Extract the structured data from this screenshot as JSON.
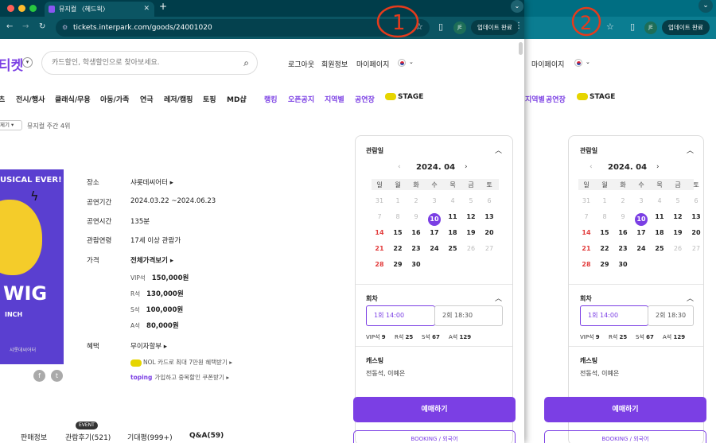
{
  "tab": {
    "title": "뮤지컬 〈헤드윅〉"
  },
  "address": {
    "url": "tickets.interpark.com/goods/24001020"
  },
  "toolbar": {
    "profile": "JE",
    "update_label": "업데이트 완료"
  },
  "header": {
    "logo": "티켓",
    "search_placeholder": "카드할인, 학생할인으로 찾아보세요.",
    "links": [
      "로그아웃",
      "회원정보",
      "마이페이지"
    ]
  },
  "menu": {
    "items": [
      "츠",
      "전시/행사",
      "클래식/무용",
      "아동/가족",
      "연극",
      "레저/캠핑",
      "토핑",
      "MD샵"
    ],
    "purple_items": [
      "랭킹",
      "오픈공지",
      "지역별",
      "공연장"
    ],
    "stage": "STAGE"
  },
  "category": {
    "select": "제기",
    "rank": "뮤지컬 주간 4위"
  },
  "poster": {
    "line1": "USICAL EVER!",
    "line2": "WIG",
    "line3": "INCH",
    "line4": "샤롯데씨어터"
  },
  "info": {
    "venue_label": "장소",
    "venue": "샤롯데씨어터 ▸",
    "period_label": "공연기간",
    "period": "2024.03.22 ~2024.06.23",
    "runtime_label": "공연시간",
    "runtime": "135분",
    "age_label": "관람연령",
    "age": "17세 이상 관람가",
    "price_label": "가격",
    "price_all": "전체가격보기 ▸",
    "prices": [
      {
        "grade": "VIP석",
        "price": "150,000원"
      },
      {
        "grade": "R석",
        "price": "130,000원"
      },
      {
        "grade": "S석",
        "price": "100,000원"
      },
      {
        "grade": "A석",
        "price": "80,000원"
      }
    ],
    "benefit_label": "혜택",
    "benefit": "무이자할부 ▸",
    "nol_benefit": "NOL 카드로 최대 7만원 혜택받기 ▸",
    "toping_brand": "toping",
    "toping_benefit": "가입하고 중복할인 쿠폰받기 ▸"
  },
  "bottom_tabs": [
    "판매정보",
    "관람후기(521)",
    "기대평(999+)",
    "Q&A(59)"
  ],
  "bottom_badge": "EVENT",
  "booking": {
    "date_title": "관람일",
    "month": "2024. 04",
    "weekdays": [
      "일",
      "월",
      "화",
      "수",
      "목",
      "금",
      "토"
    ],
    "weeks": [
      [
        "31",
        "1",
        "2",
        "3",
        "4",
        "5",
        "6"
      ],
      [
        "7",
        "8",
        "9",
        "10",
        "11",
        "12",
        "13"
      ],
      [
        "14",
        "15",
        "16",
        "17",
        "18",
        "19",
        "20"
      ],
      [
        "21",
        "22",
        "23",
        "24",
        "25",
        "26",
        "27"
      ],
      [
        "28",
        "29",
        "30",
        "",
        "",
        "",
        ""
      ]
    ],
    "selected_day": "10",
    "session_title": "회차",
    "sessions": [
      "1회 14:00",
      "2회 18:30"
    ],
    "seats": [
      {
        "grade": "VIP석",
        "count": "9"
      },
      {
        "grade": "R석",
        "count": "25"
      },
      {
        "grade": "S석",
        "count": "67"
      },
      {
        "grade": "A석",
        "count": "129"
      }
    ],
    "cast_title": "캐스팅",
    "cast": "전동석, 이예은",
    "book_button": "예매하기",
    "book_secondary": "BOOKING / 외국어"
  },
  "annotations": {
    "one": "1",
    "two": "2"
  },
  "colors": {
    "accent": "#7b3fe4",
    "chrome": "#0b5563",
    "annotation": "#e53b1c"
  }
}
